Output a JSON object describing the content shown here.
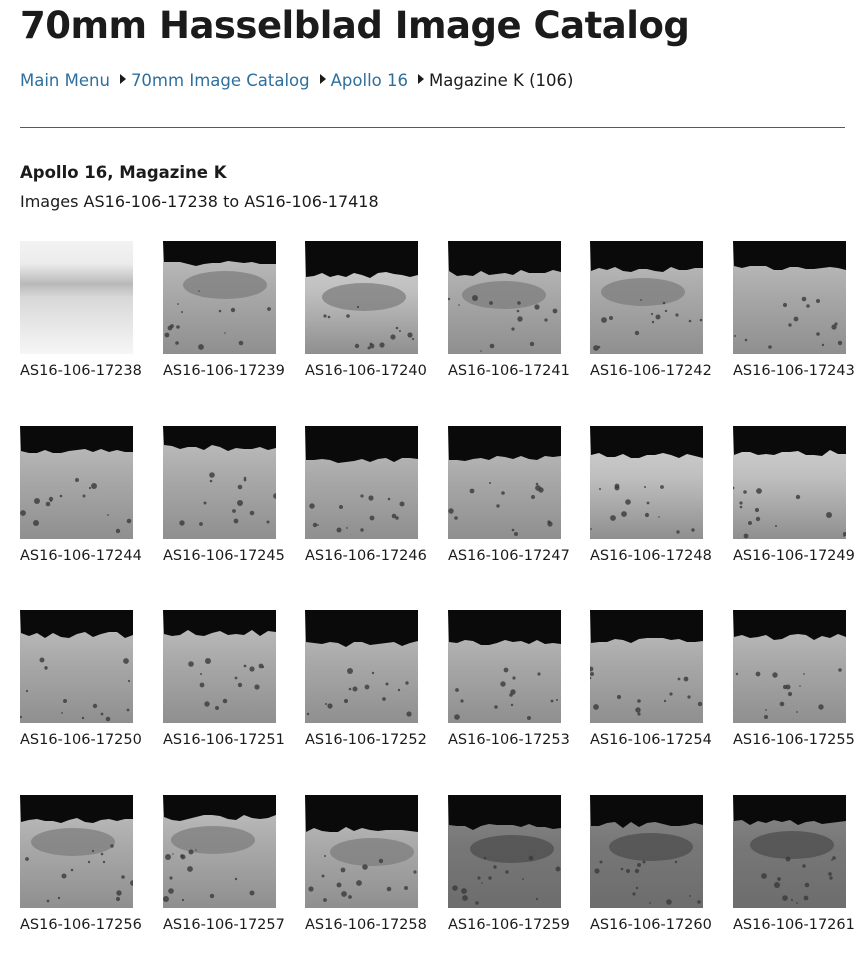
{
  "page": {
    "title": "70mm Hasselblad Image Catalog"
  },
  "breadcrumb": {
    "items": [
      {
        "label": "Main Menu",
        "link": true
      },
      {
        "label": "70mm Image Catalog",
        "link": true
      },
      {
        "label": "Apollo 16",
        "link": true
      },
      {
        "label": "Magazine K (106)",
        "link": false
      }
    ],
    "separator_icon": "triangle-right-icon"
  },
  "section": {
    "heading": "Apollo 16, Magazine K",
    "subheading": "Images AS16-106-17238 to AS16-106-17418"
  },
  "images": [
    {
      "label": "AS16-106-17238",
      "scene": "overexposed"
    },
    {
      "label": "AS16-106-17239",
      "scene": "crater"
    },
    {
      "label": "AS16-106-17240",
      "scene": "crater-bright"
    },
    {
      "label": "AS16-106-17241",
      "scene": "crater"
    },
    {
      "label": "AS16-106-17242",
      "scene": "crater"
    },
    {
      "label": "AS16-106-17243",
      "scene": "plain"
    },
    {
      "label": "AS16-106-17244",
      "scene": "plain"
    },
    {
      "label": "AS16-106-17245",
      "scene": "plain"
    },
    {
      "label": "AS16-106-17246",
      "scene": "plain"
    },
    {
      "label": "AS16-106-17247",
      "scene": "plain"
    },
    {
      "label": "AS16-106-17248",
      "scene": "plain-bright"
    },
    {
      "label": "AS16-106-17249",
      "scene": "plain-bright"
    },
    {
      "label": "AS16-106-17250",
      "scene": "plain"
    },
    {
      "label": "AS16-106-17251",
      "scene": "plain"
    },
    {
      "label": "AS16-106-17252",
      "scene": "plain"
    },
    {
      "label": "AS16-106-17253",
      "scene": "plain"
    },
    {
      "label": "AS16-106-17254",
      "scene": "plain"
    },
    {
      "label": "AS16-106-17255",
      "scene": "plain"
    },
    {
      "label": "AS16-106-17256",
      "scene": "crater"
    },
    {
      "label": "AS16-106-17257",
      "scene": "crater"
    },
    {
      "label": "AS16-106-17258",
      "scene": "crater"
    },
    {
      "label": "AS16-106-17259",
      "scene": "crater-dark"
    },
    {
      "label": "AS16-106-17260",
      "scene": "crater-dark"
    },
    {
      "label": "AS16-106-17261",
      "scene": "crater-dark"
    }
  ],
  "colors": {
    "link": "#2e6f9e",
    "text": "#1b1b1b",
    "divider": "#5a5a5a"
  }
}
